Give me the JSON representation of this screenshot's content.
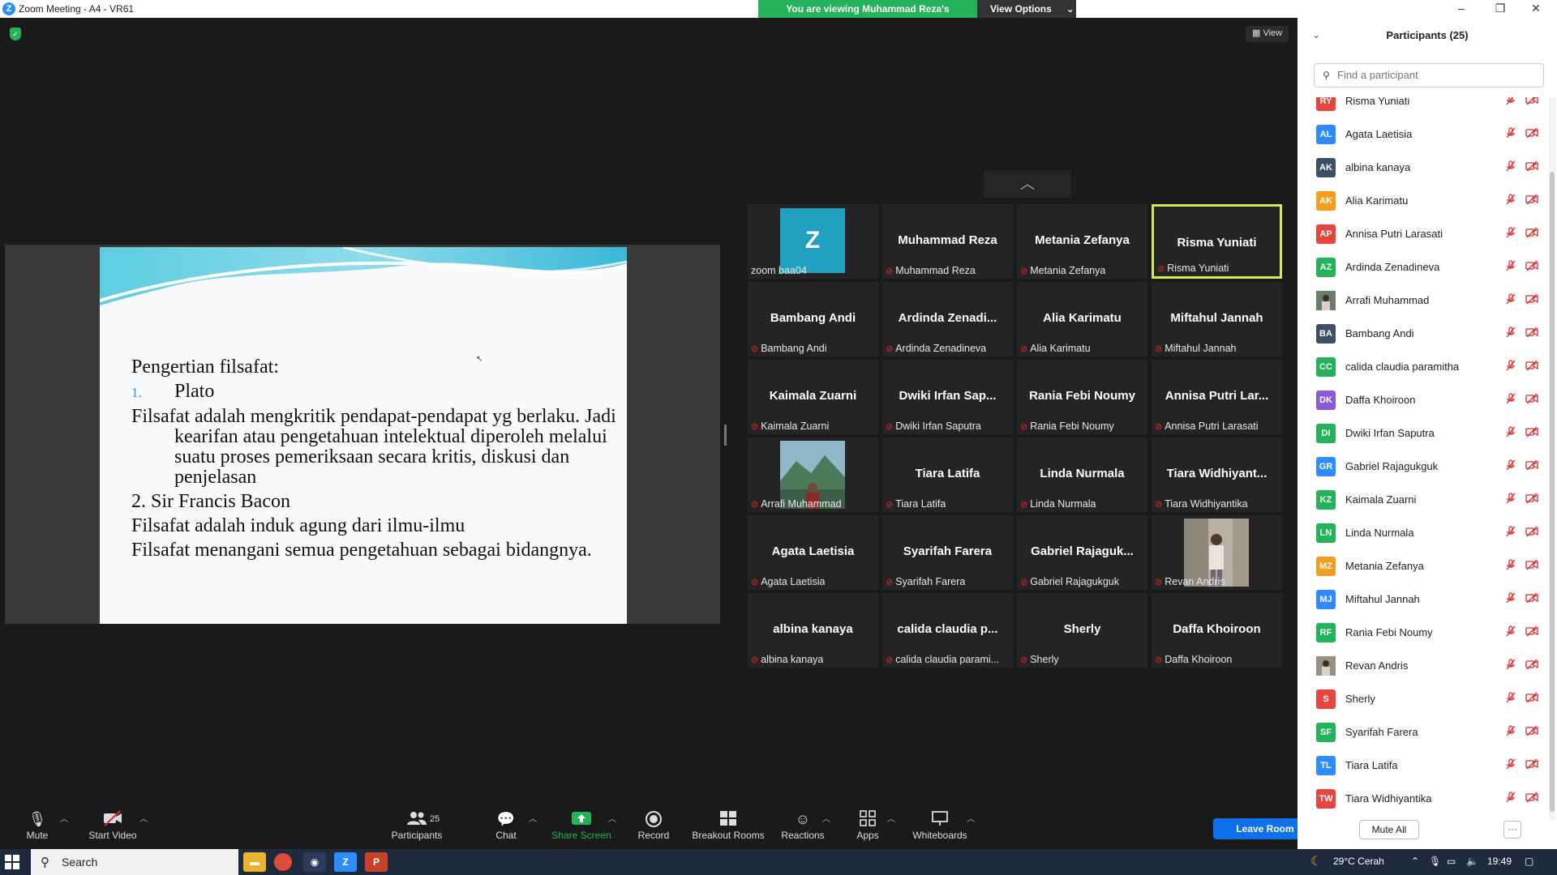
{
  "window": {
    "title": "Zoom Meeting - A4 - VR61"
  },
  "share_banner": {
    "text": "You are viewing Muhammad Reza's screen",
    "view_options": "View Options"
  },
  "view_button": "View",
  "slide": {
    "heading": "Pengertian filsafat:",
    "item1_num": "1.",
    "item1": "Plato",
    "para1": "Filsafat adalah mengkritik pendapat-pendapat yg berlaku. Jadi kearifan atau pengetahuan intelektual diperoleh melalui suatu proses pemeriksaan secara kritis, diskusi dan penjelasan",
    "item2": "2. Sir Francis Bacon",
    "para2": "Filsafat adalah induk agung dari ilmu-ilmu",
    "para3": "Filsafat menangani semua pengetahuan sebagai bidangnya."
  },
  "gallery": [
    {
      "big": "",
      "name": "zoom baa04",
      "avatar_letter": "Z",
      "muted": false
    },
    {
      "big": "Muhammad Reza",
      "name": "Muhammad Reza",
      "muted": true
    },
    {
      "big": "Metania Zefanya",
      "name": "Metania Zefanya",
      "muted": true
    },
    {
      "big": "Risma Yuniati",
      "name": "Risma Yuniati",
      "muted": true,
      "active": true
    },
    {
      "big": "Bambang Andi",
      "name": "Bambang Andi",
      "muted": true
    },
    {
      "big": "Ardinda  Zenadi...",
      "name": "Ardinda Zenadineva",
      "muted": true
    },
    {
      "big": "Alia Karimatu",
      "name": "Alia Karimatu",
      "muted": true
    },
    {
      "big": "Miftahul Jannah",
      "name": "Miftahul Jannah",
      "muted": true
    },
    {
      "big": "Kaimala Zuarni",
      "name": "Kaimala Zuarni",
      "muted": true
    },
    {
      "big": "Dwiki  Irfan  Sap...",
      "name": "Dwiki Irfan Saputra",
      "muted": true
    },
    {
      "big": "Rania Febi Noumy",
      "name": "Rania Febi Noumy",
      "muted": true
    },
    {
      "big": "Annisa  Putri  Lar...",
      "name": "Annisa Putri Larasati",
      "muted": true
    },
    {
      "big": "",
      "name": "Arrafi Muhammad",
      "muted": true,
      "photo": "mountain"
    },
    {
      "big": "Tiara Latifa",
      "name": "Tiara Latifa",
      "muted": true
    },
    {
      "big": "Linda Nurmala",
      "name": "Linda Nurmala",
      "muted": true
    },
    {
      "big": "Tiara  Widhiyant...",
      "name": "Tiara Widhiyantika",
      "muted": true
    },
    {
      "big": "Agata Laetisia",
      "name": "Agata Laetisia",
      "muted": true
    },
    {
      "big": "Syarifah Farera",
      "name": "Syarifah Farera",
      "muted": true
    },
    {
      "big": "Gabriel  Rajaguk...",
      "name": "Gabriel Rajagukguk",
      "muted": true
    },
    {
      "big": "",
      "name": "Revan Andris",
      "muted": true,
      "photo": "person"
    },
    {
      "big": "albina kanaya",
      "name": "albina kanaya",
      "muted": true
    },
    {
      "big": "calida  claudia  p...",
      "name": "calida claudia parami...",
      "muted": true
    },
    {
      "big": "Sherly",
      "name": "Sherly",
      "muted": true
    },
    {
      "big": "Daffa Khoiroon",
      "name": "Daffa Khoiroon",
      "muted": true
    }
  ],
  "toolbar": {
    "mute": "Mute",
    "start_video": "Start Video",
    "participants": "Participants",
    "participants_count": "25",
    "chat": "Chat",
    "share_screen": "Share Screen",
    "record": "Record",
    "breakout_rooms": "Breakout Rooms",
    "reactions": "Reactions",
    "apps": "Apps",
    "whiteboards": "Whiteboards",
    "leave": "Leave Room"
  },
  "panel": {
    "title": "Participants (25)",
    "search_placeholder": "Find a participant",
    "mute_all": "Mute All",
    "more": "···",
    "participants": [
      {
        "initials": "RY",
        "name": "Risma Yuniati",
        "color": "#e8453c"
      },
      {
        "initials": "AL",
        "name": "Agata Laetisia",
        "color": "#2d8cff"
      },
      {
        "initials": "AK",
        "name": "albina kanaya",
        "color": "#3d4f66"
      },
      {
        "initials": "AK",
        "name": "Alia Karimatu",
        "color": "#f59d1f"
      },
      {
        "initials": "AP",
        "name": "Annisa Putri Larasati",
        "color": "#e8453c"
      },
      {
        "initials": "AZ",
        "name": "Ardinda Zenadineva",
        "color": "#24b35a"
      },
      {
        "initials": "",
        "name": "Arrafi Muhammad",
        "color": "#6b7d6a",
        "photo": true
      },
      {
        "initials": "BA",
        "name": "Bambang Andi",
        "color": "#3d4f66"
      },
      {
        "initials": "CC",
        "name": "calida claudia paramitha",
        "color": "#24b35a"
      },
      {
        "initials": "DK",
        "name": "Daffa Khoiroon",
        "color": "#8a5ad8"
      },
      {
        "initials": "DI",
        "name": "Dwiki Irfan Saputra",
        "color": "#24b35a"
      },
      {
        "initials": "GR",
        "name": "Gabriel Rajagukguk",
        "color": "#2d8cff"
      },
      {
        "initials": "KZ",
        "name": "Kaimala Zuarni",
        "color": "#24b35a"
      },
      {
        "initials": "LN",
        "name": "Linda Nurmala",
        "color": "#24b35a"
      },
      {
        "initials": "MZ",
        "name": "Metania Zefanya",
        "color": "#f59d1f"
      },
      {
        "initials": "MJ",
        "name": "Miftahul Jannah",
        "color": "#2d8cff"
      },
      {
        "initials": "RF",
        "name": "Rania Febi Noumy",
        "color": "#24b35a"
      },
      {
        "initials": "",
        "name": "Revan Andris",
        "color": "#9a8f80",
        "photo": true
      },
      {
        "initials": "S",
        "name": "Sherly",
        "color": "#e8453c"
      },
      {
        "initials": "SF",
        "name": "Syarifah Farera",
        "color": "#24b35a"
      },
      {
        "initials": "TL",
        "name": "Tiara Latifa",
        "color": "#2d8cff"
      },
      {
        "initials": "TW",
        "name": "Tiara Widhiyantika",
        "color": "#e8453c"
      }
    ]
  },
  "taskbar": {
    "search": "Search",
    "weather": "29°C  Cerah",
    "time": "19:49"
  },
  "colors": {
    "accent": "#2d8cff",
    "green": "#24b35a",
    "muted_red": "#e02828",
    "active_border": "#d4e65c",
    "leave": "#0e71eb"
  }
}
